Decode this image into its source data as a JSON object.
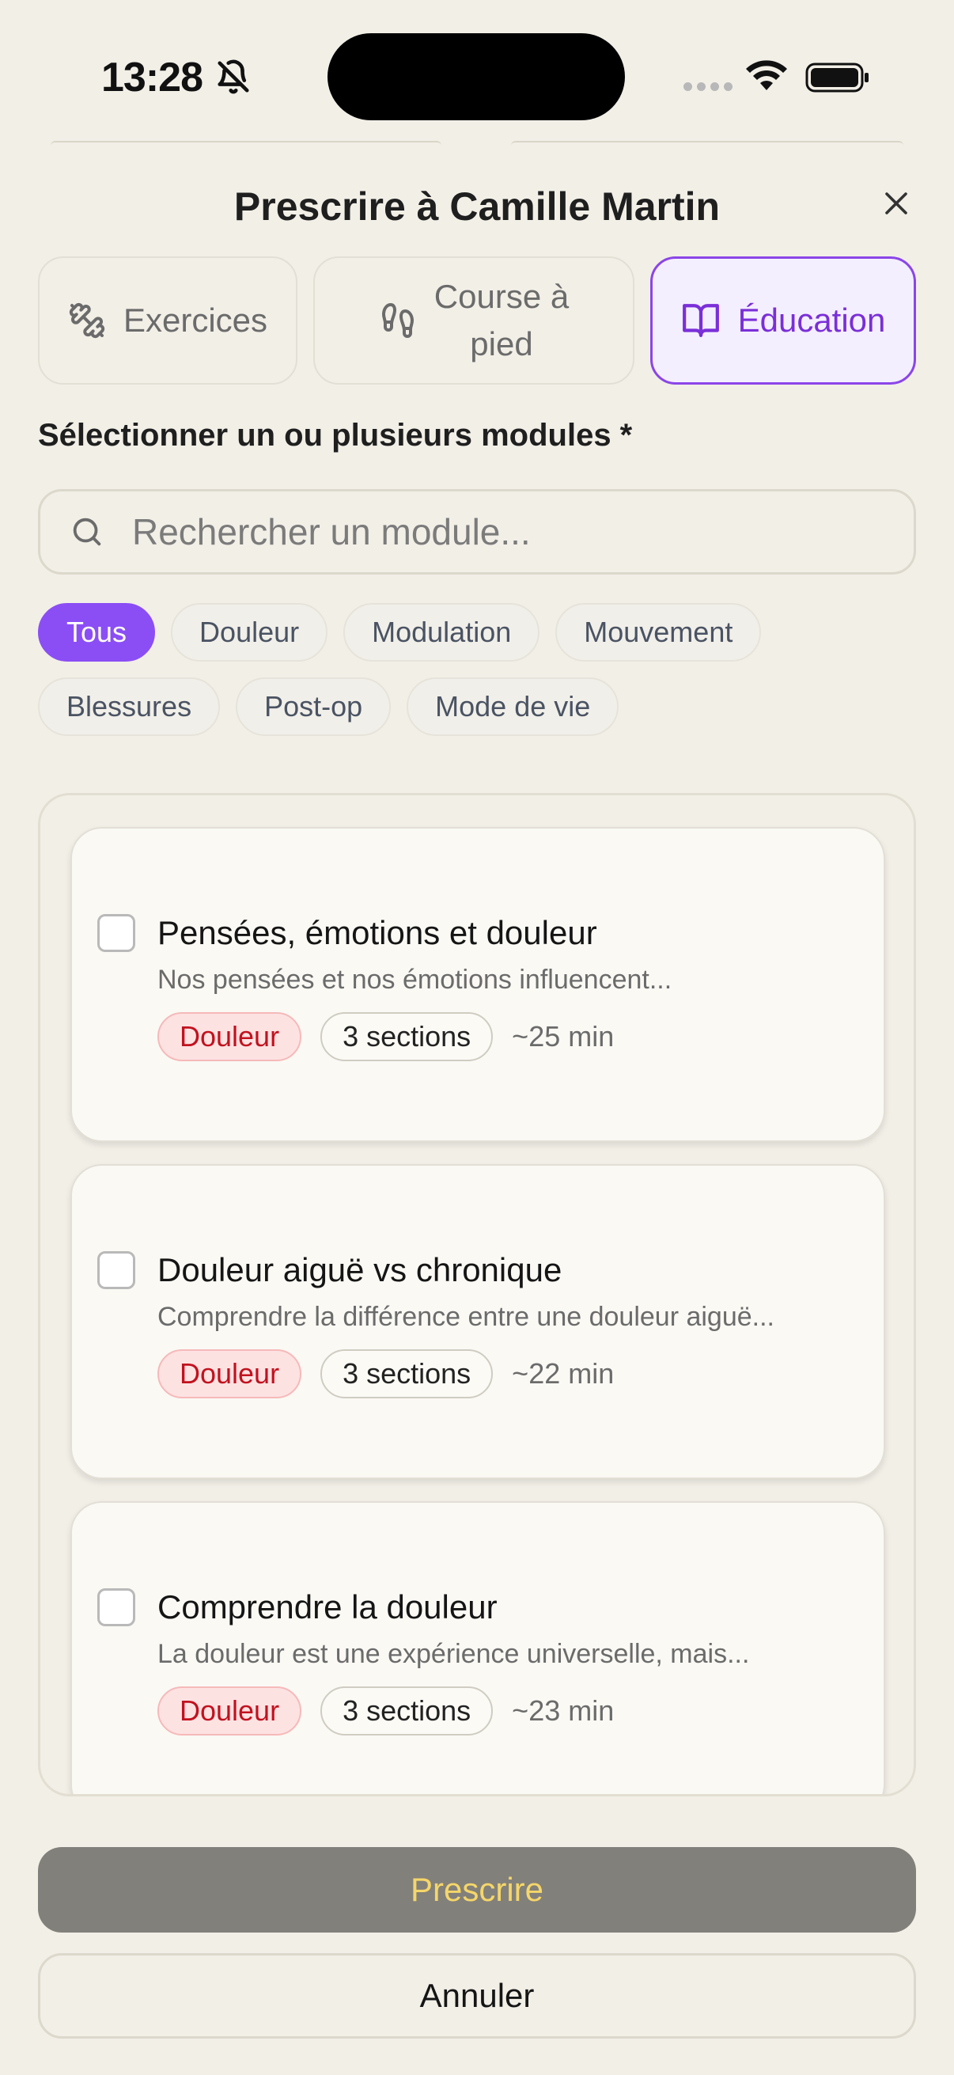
{
  "status_bar": {
    "time": "13:28",
    "icons": [
      "bell-slash-icon",
      "signal-icon",
      "wifi-icon",
      "battery-icon"
    ]
  },
  "sheet": {
    "title": "Prescrire à Camille Martin",
    "close_icon": "close-icon"
  },
  "tabs": [
    {
      "label": "Exercices",
      "icon": "dumbbell-icon",
      "active": false
    },
    {
      "label_line1": "Course à",
      "label_line2": "pied",
      "icon": "footprints-icon",
      "active": false
    },
    {
      "label": "Éducation",
      "icon": "book-open-icon",
      "active": true
    }
  ],
  "modules_label": "Sélectionner un ou plusieurs modules *",
  "search": {
    "placeholder": "Rechercher un module...",
    "value": ""
  },
  "filters": [
    {
      "label": "Tous",
      "active": true
    },
    {
      "label": "Douleur",
      "active": false
    },
    {
      "label": "Modulation",
      "active": false
    },
    {
      "label": "Mouvement",
      "active": false
    },
    {
      "label": "Blessures",
      "active": false
    },
    {
      "label": "Post-op",
      "active": false
    },
    {
      "label": "Mode de vie",
      "active": false
    }
  ],
  "modules": [
    {
      "title": "Pensées, émotions et douleur",
      "description": "Nos pensées et nos émotions influencent...",
      "category": "Douleur",
      "sections": "3 sections",
      "duration": "~25 min",
      "checked": false
    },
    {
      "title": "Douleur aiguë vs chronique",
      "description": "Comprendre la différence entre une douleur aiguë...",
      "category": "Douleur",
      "sections": "3 sections",
      "duration": "~22 min",
      "checked": false
    },
    {
      "title": "Comprendre la douleur",
      "description": "La douleur est une expérience universelle, mais...",
      "category": "Douleur",
      "sections": "3 sections",
      "duration": "~23 min",
      "checked": false
    }
  ],
  "actions": {
    "primary": "Prescrire",
    "secondary": "Annuler"
  },
  "colors": {
    "background": "#f2efe7",
    "accent": "#8b4ef5",
    "accent_text": "#7a2fd8",
    "category_red": "#c1121f",
    "primary_button_bg": "#82807a",
    "primary_button_text": "#f5d66a"
  }
}
